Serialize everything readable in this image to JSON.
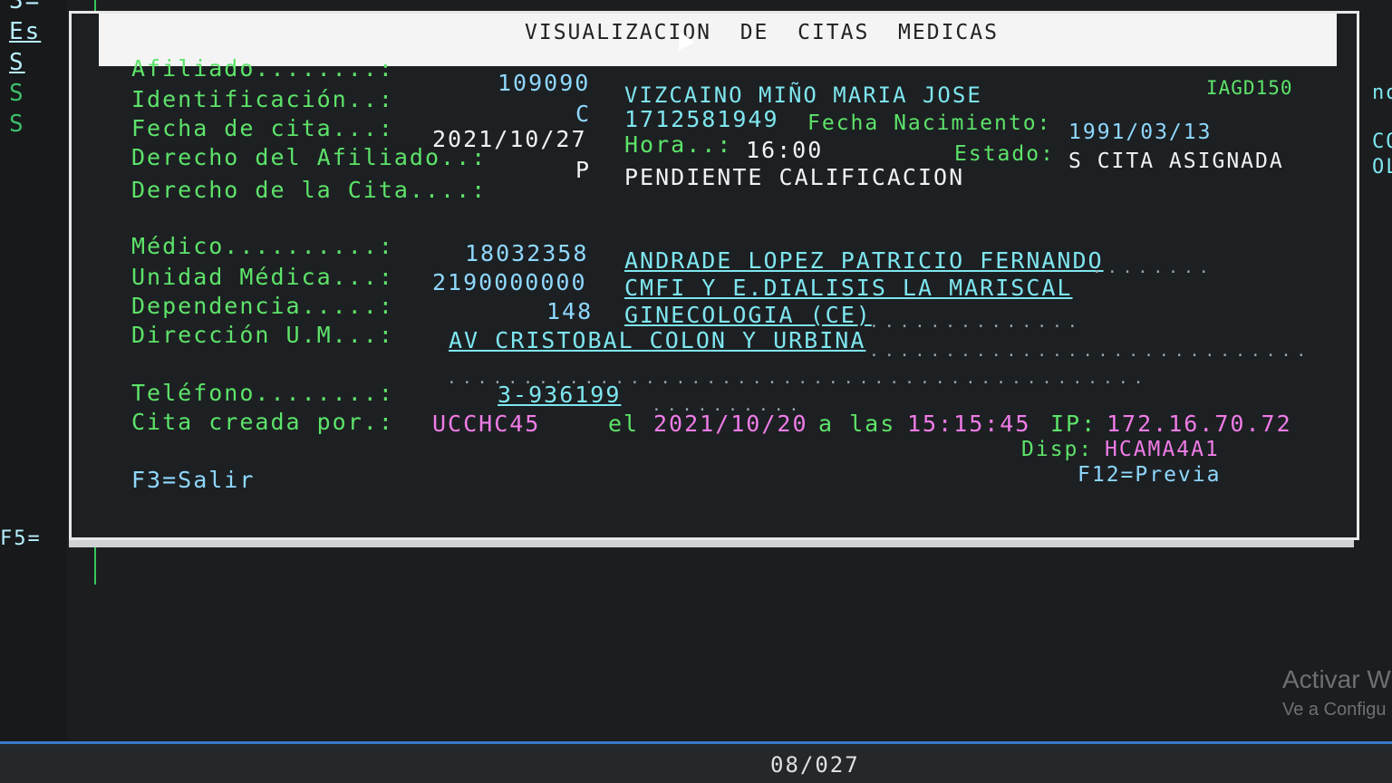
{
  "sidebar": {
    "items": [
      "Es",
      "S",
      "S",
      "S"
    ],
    "f5": "F5="
  },
  "dialog": {
    "title": "VISUALIZACION  DE  CITAS  MEDICAS",
    "program_id": "IAGD150"
  },
  "fields": {
    "afiliado_label": "Afiliado........:",
    "afiliado_value": "109090",
    "afiliado_name": "VIZCAINO MIÑO MARIA JOSE",
    "identificacion_label": "Identificación..:",
    "identificacion_type": "C",
    "identificacion_value": "1712581949",
    "fecha_nacimiento_label": "Fecha Nacimiento:",
    "fecha_nacimiento_value": "1991/03/13",
    "fecha_cita_label": "Fecha de cita...:",
    "fecha_cita_value": "2021/10/27",
    "hora_label": "Hora..:",
    "hora_value": "16:00",
    "estado_label": "Estado:",
    "estado_value": "S CITA ASIGNADA",
    "derecho_afiliado_label": "Derecho del Afiliado..:",
    "derecho_afiliado_code": "P",
    "derecho_afiliado_value": "PENDIENTE CALIFICACION",
    "derecho_cita_label": "Derecho de la Cita....:",
    "medico_label": "Médico..........:",
    "medico_value": "18032358",
    "medico_name": "ANDRADE LOPEZ PATRICIO FERNANDO",
    "unidad_label": "Unidad Médica...:",
    "unidad_value": "2190000000",
    "unidad_name": "CMFI Y E.DIALISIS LA MARISCAL",
    "dependencia_label": "Dependencia.....:",
    "dependencia_value": "148",
    "dependencia_name": "GINECOLOGIA (CE)",
    "direccion_label": "Dirección U.M...:",
    "direccion_value": "AV CRISTOBAL COLON Y URBINA",
    "telefono_label": "Teléfono........:",
    "telefono_value": "3-936199",
    "creada_label": "Cita creada por.:",
    "creada_user": "UCCHC45",
    "el_label": "el",
    "creada_date": "2021/10/20",
    "a_las_label": "a las",
    "creada_time": "15:15:45",
    "ip_label": "IP:",
    "ip_value": "172.16.70.72",
    "disp_label": "Disp:",
    "disp_value": "HCAMA4A1"
  },
  "keys": {
    "f3": "F3=Salir",
    "f12": "F12=Previa"
  },
  "status": {
    "page_counter": "08/027"
  },
  "watermark": {
    "line1": "Activar W",
    "line2": "Ve a Configu"
  },
  "right_edge": [
    "no",
    "CO",
    "OL"
  ]
}
